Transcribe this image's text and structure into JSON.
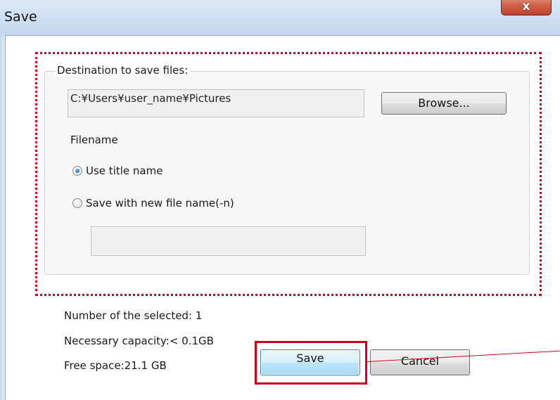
{
  "window": {
    "title": "Save",
    "close_glyph": "x"
  },
  "destination": {
    "group_label": "Destination to save files:",
    "path_value": "C:¥Users¥user_name¥Pictures",
    "browse_label": "Browse..."
  },
  "filename": {
    "heading": "Filename",
    "options": [
      {
        "label": "Use title name",
        "selected": true
      },
      {
        "label": "Save with new file name(-n)",
        "selected": false
      }
    ],
    "new_name_value": ""
  },
  "info": {
    "selected_count": "Number of the selected: 1",
    "necessary_capacity": "Necessary capacity:< 0.1GB",
    "free_space": "Free space:21.1 GB"
  },
  "actions": {
    "save_label": "Save",
    "cancel_label": "Cancel"
  },
  "annotation": {
    "color": "#d0021b"
  },
  "icons": {
    "close": "close-icon",
    "radio": "radio-button-icon"
  }
}
